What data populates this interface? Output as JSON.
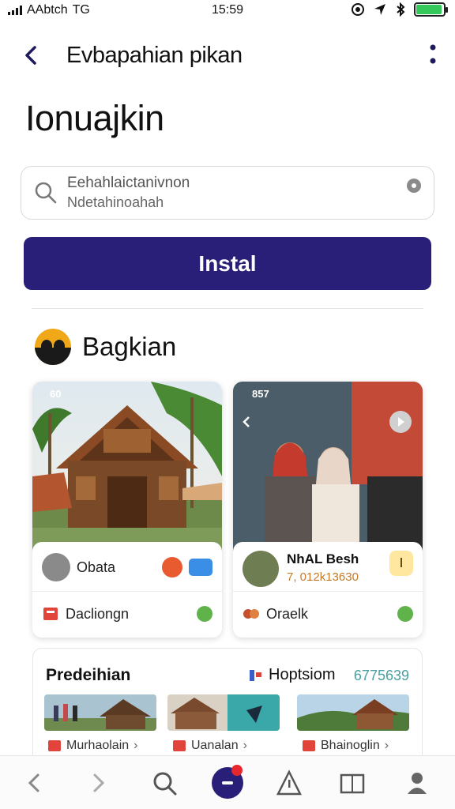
{
  "status_bar": {
    "carrier": "AAbtch",
    "network": "TG",
    "time": "15:59",
    "battery_level": 0.95
  },
  "nav": {
    "title": "Evbapahian pikan",
    "back_icon": "chevron-left-icon",
    "more_icon": "more-vertical-icon"
  },
  "page_title": "Ionuajkin",
  "search": {
    "line1": "Eehahlaictanivnon",
    "line2": "Ndetahinoahah"
  },
  "install_button": "Instal",
  "section": {
    "title": "Bagkian"
  },
  "cards": [
    {
      "status_time": "60",
      "row1_label": "Obata",
      "row2_label": "Dacliongn"
    },
    {
      "status_time": "857",
      "name": "NhAL Besh",
      "number": "7, 012k13630",
      "row2_label": "Oraelk"
    }
  ],
  "bottom_card": {
    "title": "Predeihian",
    "option": "Hoptsiom",
    "number": "6775639",
    "items": [
      {
        "label": "Murhaolain"
      },
      {
        "label": "Uanalan"
      },
      {
        "label": "Bhainoglin"
      }
    ]
  },
  "tabbar": {
    "badge_color": "#e8262e",
    "accent": "#2a1f78"
  }
}
